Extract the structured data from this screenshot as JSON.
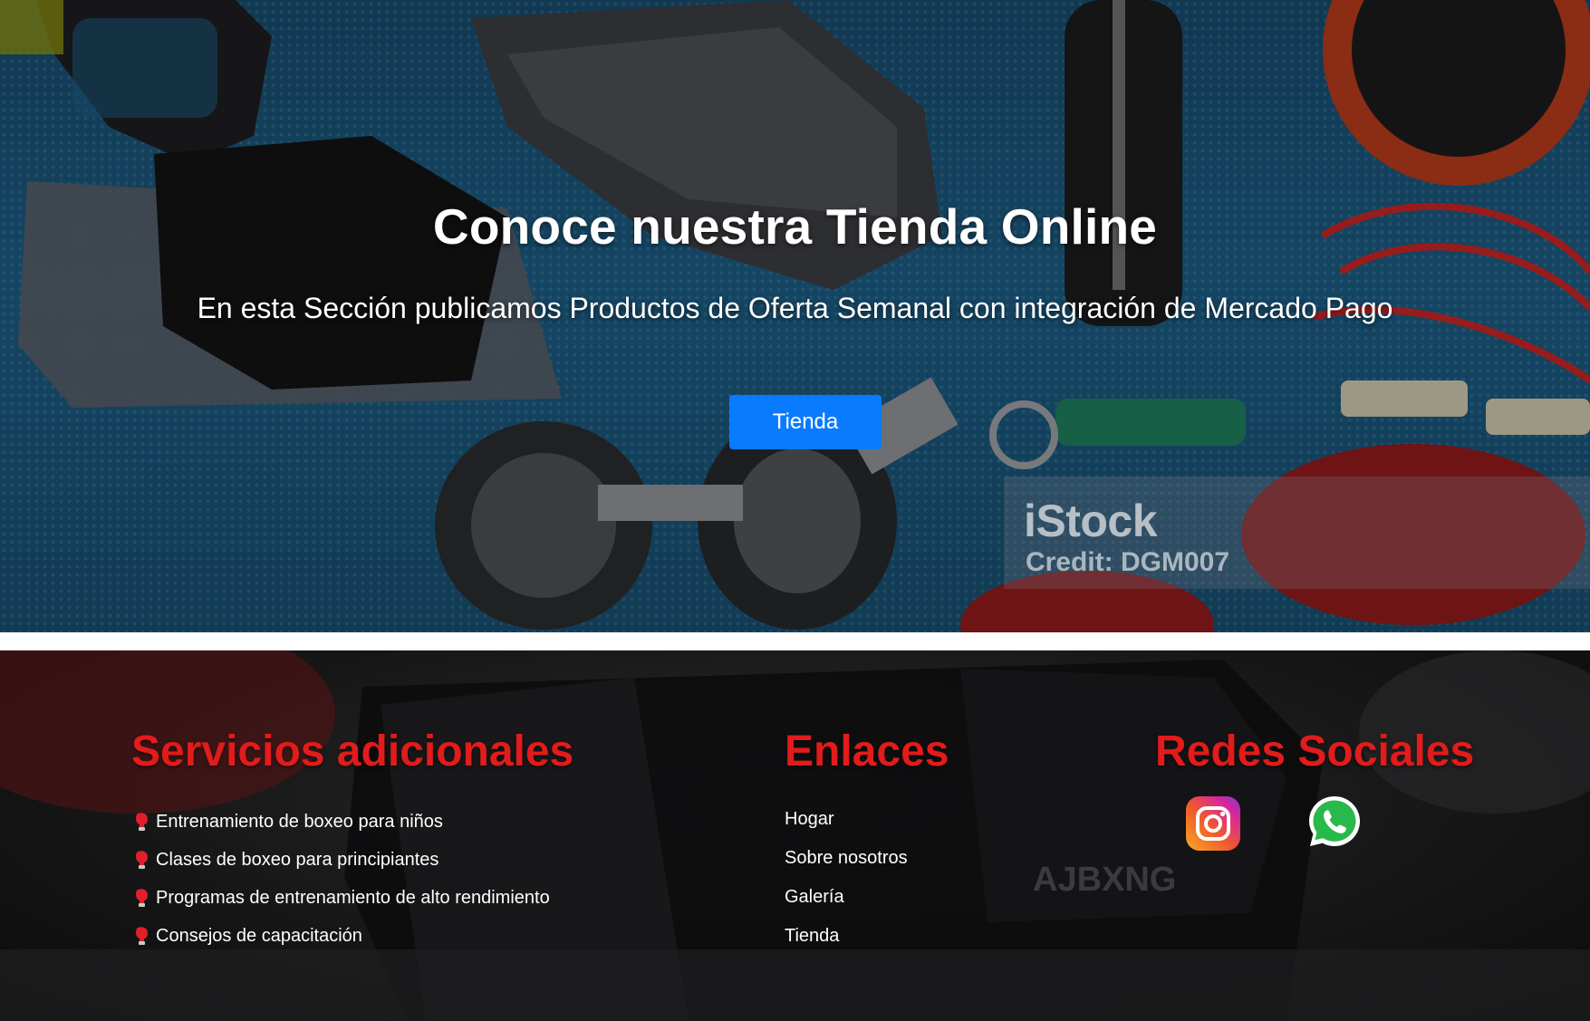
{
  "hero": {
    "title": "Conoce nuestra Tienda Online",
    "subtitle": "En esta Sección publicamos Productos de Oferta Semanal con integración de Mercado Pago",
    "button_label": "Tienda",
    "watermark": {
      "logo": "iStock",
      "credit": "Credit: DGM007"
    },
    "background_image": "fitness-equipment-photo"
  },
  "footer": {
    "background_image": "boxing-glove-photo",
    "services": {
      "heading": "Servicios adicionales",
      "icon": "boxing-glove-icon",
      "items": [
        "Entrenamiento de boxeo para niños",
        "Clases de boxeo para principiantes",
        "Programas de entrenamiento de alto rendimiento",
        "Consejos de capacitación"
      ]
    },
    "links": {
      "heading": "Enlaces",
      "items": [
        "Hogar",
        "Sobre nosotros",
        "Galería",
        "Tienda"
      ]
    },
    "social": {
      "heading": "Redes Sociales",
      "icons": [
        "instagram-icon",
        "whatsapp-icon"
      ]
    }
  },
  "colors": {
    "accent_blue": "#0a7bff",
    "heading_red": "#e21b1b",
    "footer_background": "#161617",
    "hero_background": "#1a5a80"
  }
}
